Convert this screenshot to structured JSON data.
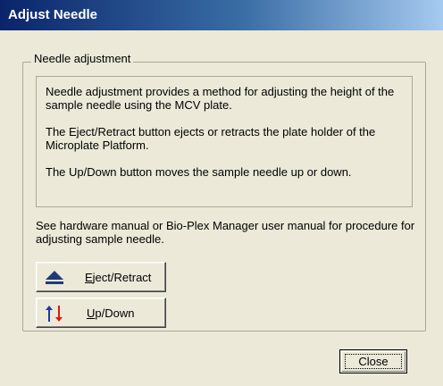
{
  "window": {
    "title": "Adjust Needle"
  },
  "group": {
    "label": "Needle adjustment"
  },
  "info": {
    "paragraphs": [
      "Needle adjustment provides a method for adjusting the height of the sample needle using the MCV plate.",
      "The Eject/Retract button ejects or retracts the plate holder of the Microplate Platform.",
      "The Up/Down button moves the sample needle up or down."
    ]
  },
  "note": "See hardware manual or Bio-Plex Manager user manual for procedure for adjusting sample needle.",
  "buttons": {
    "eject": {
      "mnemonic": "E",
      "rest": "ject/Retract",
      "icon": "eject-icon"
    },
    "updown": {
      "mnemonic": "U",
      "rest": "p/Down",
      "icon": "up-down-arrows-icon"
    },
    "close": {
      "label": "Close"
    }
  },
  "colors": {
    "titlebar_start": "#0a246a",
    "titlebar_end": "#a6caf0",
    "dialog_bg": "#ece9d8",
    "eject_icon": "#1f3a7a",
    "up_arrow": "#1f3a9e",
    "down_arrow": "#e21414"
  }
}
